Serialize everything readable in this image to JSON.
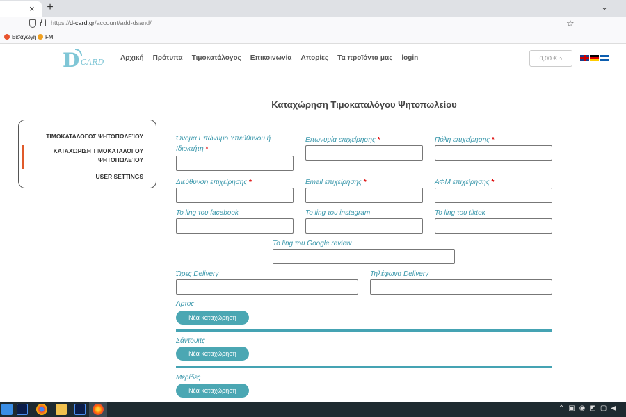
{
  "browser": {
    "tab_close": "×",
    "new_tab": "+",
    "tab_menu": "⌄",
    "url_prefix": "https://",
    "url_domain": "d-card.gr",
    "url_path": "/account/add-dsand/",
    "bookmarks": [
      {
        "label": "Εισαγωγή",
        "color": "#e8542f"
      },
      {
        "label": "FM",
        "color": "#f0a020"
      }
    ]
  },
  "site": {
    "logo_d": "D",
    "logo_card": "CARD",
    "menu": [
      "Αρχική",
      "Πρότυπα",
      "Τιμοκατάλογος",
      "Επικοινωνία",
      "Απορίες",
      "Τα προϊόντα μας",
      "login"
    ],
    "cart": "0,00 € ⌂"
  },
  "page": {
    "title": "Καταχώρηση Τιμοκαταλόγου Ψητοπωλείου"
  },
  "sidebar": {
    "items": [
      {
        "label": "ΤΙΜΟΚΑΤΑΛΟΓΟΣ ΨΗΤΟΠΩΛΕΊΟΥ"
      },
      {
        "label": "ΚΑΤΑΧΏΡΙΣΗ ΤΙΜΟΚΑΤΑΛΟΓΟΥ ΨΗΤΟΠΩΛΕΊΟΥ"
      },
      {
        "label": "USER SETTINGS"
      }
    ]
  },
  "form": {
    "owner_label": "Όνομα Επώνυμο Υπεύθυνου ή Ιδιοκτήτη ",
    "owner_req": "*",
    "business_label": "Επωνυμία επιχείρησης ",
    "city_label": "Πόλη επιχείρησης ",
    "address_label": "Διεύθυνση επιχείρησης ",
    "email_label": "Email επιχείρησης ",
    "afm_label": "ΑΦΜ επιχείρησης ",
    "facebook_label": "To ling του facebook",
    "instagram_label": "To ling του instagram",
    "tiktok_label": "To ling του tiktok",
    "google_label": "To ling του Google review",
    "delivery_hours_label": "Ώρες Delivery",
    "delivery_phone_label": "Τηλέφωνα Delivery",
    "required_mark": "*"
  },
  "sections": [
    {
      "label": "Άρτος",
      "button": "Νέα καταχώρηση"
    },
    {
      "label": "Σάντουιτς",
      "button": "Νέα καταχώρηση"
    },
    {
      "label": "Μερίδες",
      "button": "Νέα καταχώρηση"
    }
  ],
  "colors": {
    "accent": "#4ba7b3",
    "label": "#3a97ab",
    "required": "#dd0000",
    "active_marker": "#e05a2a"
  }
}
